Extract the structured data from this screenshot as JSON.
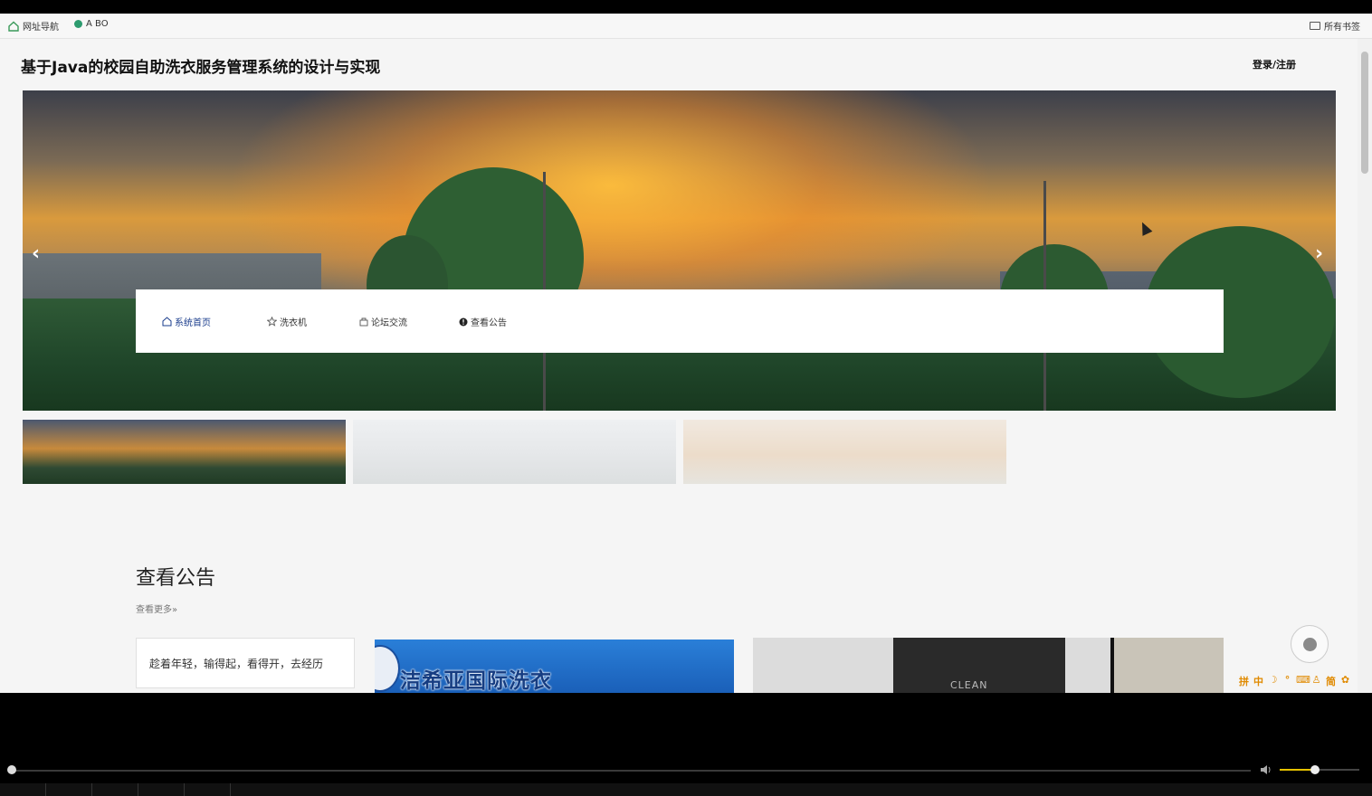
{
  "bookmarks": {
    "items": [
      {
        "label": "网址导航"
      },
      {
        "label": "A BO"
      }
    ],
    "all_bookmarks": "所有书签"
  },
  "header": {
    "title": "基于Java的校园自助洗衣服务管理系统的设计与实现",
    "login": "登录/注册"
  },
  "carousel": {
    "prev": "‹",
    "next": "›"
  },
  "nav": {
    "items": [
      {
        "label": "系统首页",
        "icon": "home-icon"
      },
      {
        "label": "洗衣机",
        "icon": "star-icon"
      },
      {
        "label": "论坛交流",
        "icon": "bag-icon"
      },
      {
        "label": "查看公告",
        "icon": "info-icon"
      }
    ]
  },
  "announcements": {
    "title": "查看公告",
    "more": "查看更多»",
    "first_text": "趁着年轻，输得起，看得开，去经历",
    "image_text": "洁希亚国际洗衣",
    "image2_text": "CLEAN"
  },
  "ime": [
    "拼",
    "中",
    "☽",
    "°",
    "⌨",
    "♙",
    "简",
    "✿"
  ]
}
